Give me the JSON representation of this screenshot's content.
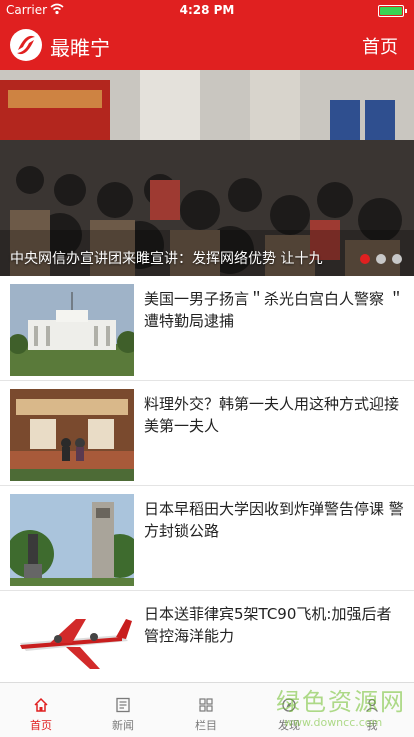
{
  "status_bar": {
    "carrier": "Carrier",
    "time": "4:28 PM"
  },
  "header": {
    "app_title": "最睢宁",
    "home_link": "首页"
  },
  "banner": {
    "caption": "中央网信办宣讲团来睢宣讲：发挥网络优势 让十九",
    "active_slide": 1,
    "slide_count": 3
  },
  "news": [
    {
      "title": "美国一男子扬言＂杀光白宫白人警察 ＂遭特勤局逮捕"
    },
    {
      "title": "料理外交？韩第一夫人用这种方式迎接美第一夫人"
    },
    {
      "title": "日本早稻田大学因收到炸弹警告停课 警方封锁公路"
    },
    {
      "title": "日本送菲律宾5架TC90飞机:加强后者管控海洋能力"
    }
  ],
  "tabs": [
    {
      "label": "首页",
      "icon": "home-icon"
    },
    {
      "label": "新闻",
      "icon": "news-icon"
    },
    {
      "label": "栏目",
      "icon": "grid-icon"
    },
    {
      "label": "发现",
      "icon": "discover-icon"
    },
    {
      "label": "我",
      "icon": "user-icon"
    }
  ],
  "watermark": {
    "text": "绿色资源网",
    "url": "www.downcc.com"
  },
  "colors": {
    "brand": "#e02020",
    "tab_inactive": "#7a7a7a"
  }
}
